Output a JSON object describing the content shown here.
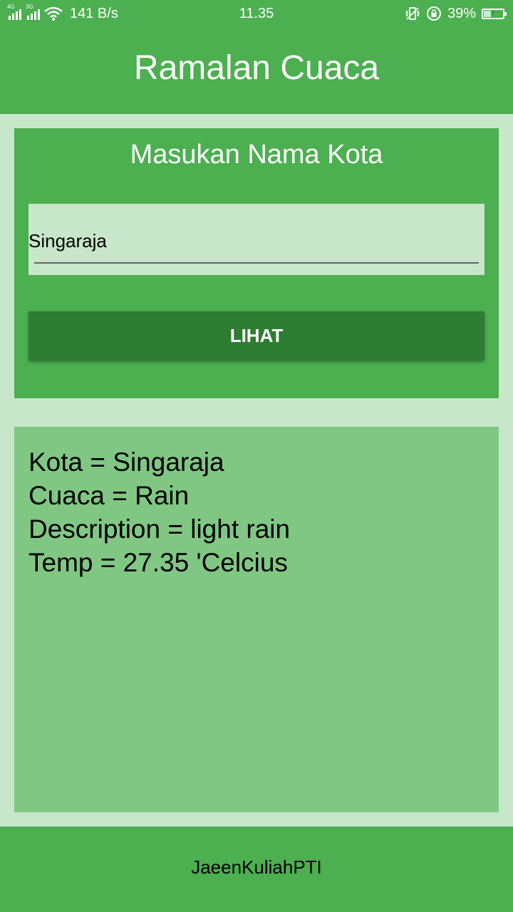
{
  "status_bar": {
    "network1": "4G",
    "network2": "3G",
    "speed": "141 B/s",
    "time": "11.35",
    "battery": "39%",
    "battery_level": 0.39,
    "icons": [
      "signal-icon",
      "wifi-icon",
      "vibrate-icon",
      "rotation-lock-icon",
      "battery-icon"
    ]
  },
  "app_bar": {
    "title": "Ramalan Cuaca"
  },
  "input_card": {
    "title": "Masukan Nama Kota",
    "city_value": "Singaraja",
    "button_label": "LIHAT"
  },
  "result": {
    "lines": [
      "Kota = Singaraja",
      "Cuaca = Rain",
      "Description = light rain",
      "Temp = 27.35 'Celcius"
    ]
  },
  "footer": {
    "text": "JaeenKuliahPTI"
  },
  "colors": {
    "primary": "#4CAF50",
    "primary_dark": "#2E7D32",
    "background": "#C8E6C9",
    "result_bg": "#81C784"
  }
}
